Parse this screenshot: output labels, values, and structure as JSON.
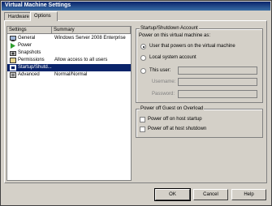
{
  "window": {
    "title": "Virtual Machine Settings"
  },
  "tabs": [
    {
      "label": "Hardware",
      "active": false
    },
    {
      "label": "Options",
      "active": true
    }
  ],
  "list": {
    "columns": [
      "Settings",
      "Summary"
    ],
    "rows": [
      {
        "name": "General",
        "summary": "Windows Server 2008 Enterprise",
        "icon": "general-icon",
        "selected": false
      },
      {
        "name": "Power",
        "summary": "",
        "icon": "power-icon",
        "selected": false
      },
      {
        "name": "Snapshots",
        "summary": "",
        "icon": "snapshots-icon",
        "selected": false
      },
      {
        "name": "Permissions",
        "summary": "Allow access to all users",
        "icon": "permissions-icon",
        "selected": false
      },
      {
        "name": "Startup/Shutd...",
        "summary": "",
        "icon": "startup-shutdown-icon",
        "selected": true
      },
      {
        "name": "Advanced",
        "summary": "Normal/Normal",
        "icon": "advanced-icon",
        "selected": false
      }
    ]
  },
  "startup_group": {
    "title": "Startup/Shutdown Account",
    "description": "Power on this virtual machine as:",
    "options": [
      {
        "label": "User that powers on the virtual machine",
        "checked": true
      },
      {
        "label": "Local system account",
        "checked": false
      },
      {
        "label": "This user:",
        "checked": false
      }
    ],
    "fields": [
      {
        "label": "Username:",
        "value": ""
      },
      {
        "label": "Password:",
        "value": ""
      }
    ]
  },
  "power_group": {
    "title": "Power off Guest on Overload",
    "checkboxes": [
      {
        "label": "Power off on host startup",
        "checked": false
      },
      {
        "label": "Power off at host shutdown",
        "checked": false
      }
    ]
  },
  "buttons": {
    "ok": "OK",
    "cancel": "Cancel",
    "help": "Help"
  }
}
